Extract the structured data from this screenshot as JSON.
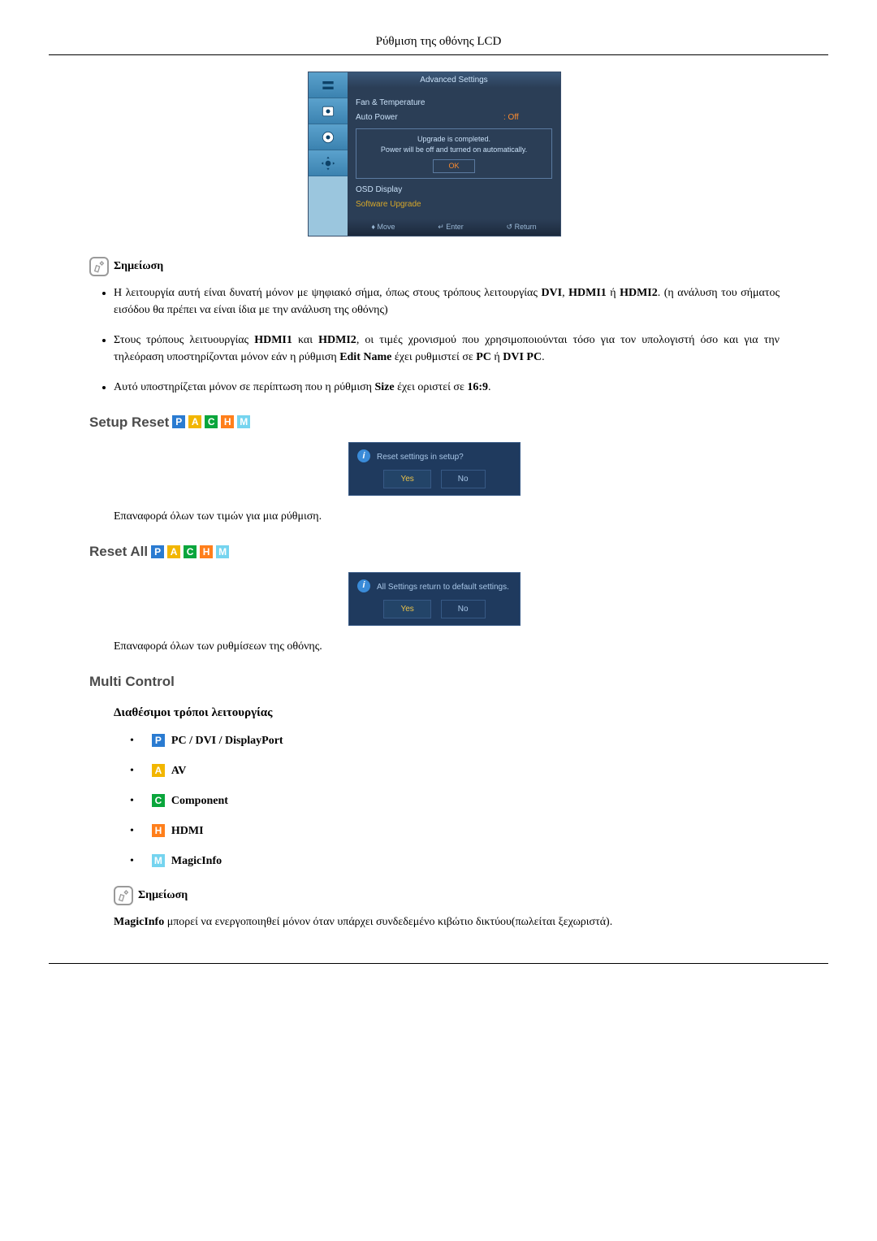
{
  "pageTitle": "Ρύθμιση της οθόνης LCD",
  "osd": {
    "header": "Advanced Settings",
    "row1": "Fan & Temperature",
    "row2label": "Auto Power",
    "row2value": ": Off",
    "msg1": "Upgrade is completed.",
    "msg2": "Power will be off and turned on automatically.",
    "ok": "OK",
    "row3": "OSD Display",
    "row4": "Software Upgrade",
    "ftMove": "Move",
    "ftEnter": "Enter",
    "ftReturn": "Return"
  },
  "noteLabel": "Σημείωση",
  "notes": {
    "b1a": "Η λειτουργία αυτή είναι δυνατή μόνον με ψηφιακό σήμα, όπως στους τρόπους λειτουργίας ",
    "b1b": "DVI",
    "b1c": ", ",
    "b1d": "HDMI1",
    "b1e": " ή ",
    "b1f": "HDMI2",
    "b1g": ". (η ανάλυση του σήματος εισόδου θα πρέπει να είναι ίδια με την ανάλυση της οθόνης)",
    "b2a": "Στους τρόπους λειτυουργίας ",
    "b2b": "HDMI1",
    "b2c": " και ",
    "b2d": "HDMI2",
    "b2e": ", οι τιμές χρονισμού που χρησιμοποιούνται τόσο για τον υπολογιστή όσο και για την τηλεόραση υποστηρίζονται μόνον εάν η ρύθμιση ",
    "b2f": "Edit Name",
    "b2g": " έχει ρυθμιστεί σε ",
    "b2h": "PC",
    "b2i": " ή ",
    "b2j": "DVI PC",
    "b2k": ".",
    "b3a": "Αυτό υποστηρίζεται μόνον σε περίπτωση που η ρύθμιση ",
    "b3b": "Size",
    "b3c": " έχει οριστεί σε ",
    "b3d": "16:9",
    "b3e": "."
  },
  "setupReset": {
    "heading": "Setup Reset",
    "dialogText": "Reset settings in setup?",
    "yes": "Yes",
    "no": "No",
    "desc": "Επαναφορά όλων των τιμών για μια ρύθμιση."
  },
  "resetAll": {
    "heading": "Reset All",
    "dialogText": "All Settings return to default settings.",
    "yes": "Yes",
    "no": "No",
    "desc": "Επαναφορά όλων των ρυθμίσεων της οθόνης."
  },
  "multiControl": {
    "heading": "Multi Control",
    "subheading": "Διαθέσιμοι τρόποι λειτουργίας",
    "modeP": "PC / DVI / DisplayPort",
    "modeA": "AV",
    "modeC": "Component",
    "modeH": "HDMI",
    "modeM": "MagicInfo",
    "noteA": "MagicInfo",
    "noteB": " μπορεί να ενεργοποιηθεί μόνον όταν υπάρχει συνδεδεμένο κιβώτιο δικτύου(πωλείται ξεχωριστά)."
  },
  "tags": {
    "P": "P",
    "A": "A",
    "C": "C",
    "H": "H",
    "M": "M"
  }
}
